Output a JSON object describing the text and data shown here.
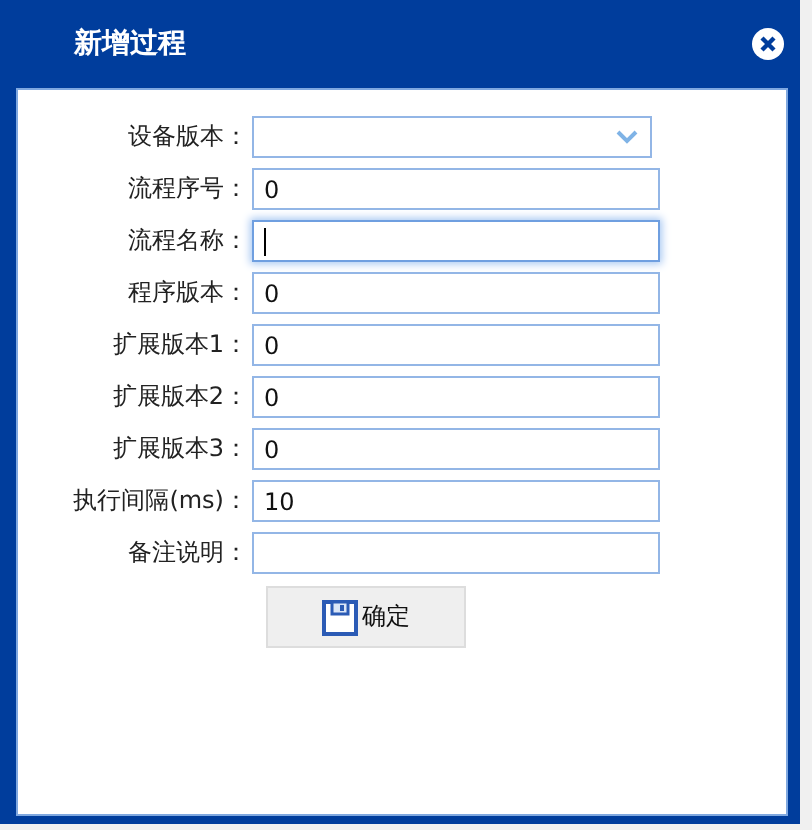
{
  "window": {
    "title": "新增过程"
  },
  "fields": [
    {
      "kind": "select",
      "label": "设备版本：",
      "focused": false
    },
    {
      "kind": "text",
      "label": "流程序号：",
      "value": "0",
      "focused": false
    },
    {
      "kind": "text",
      "label": "流程名称：",
      "focused": true
    },
    {
      "kind": "text",
      "label": "程序版本：",
      "value": "0",
      "focused": false
    },
    {
      "kind": "text",
      "label": "扩展版本1：",
      "value": "0",
      "focused": false
    },
    {
      "kind": "text",
      "label": "扩展版本2：",
      "value": "0",
      "focused": false
    },
    {
      "kind": "text",
      "label": "扩展版本3：",
      "value": "0",
      "focused": false
    },
    {
      "kind": "text",
      "label": "执行间隔(ms)：",
      "value": "10",
      "focused": false
    },
    {
      "kind": "text",
      "label": "备注说明：",
      "focused": false
    }
  ],
  "buttons": [
    {
      "label": "确定"
    }
  ]
}
